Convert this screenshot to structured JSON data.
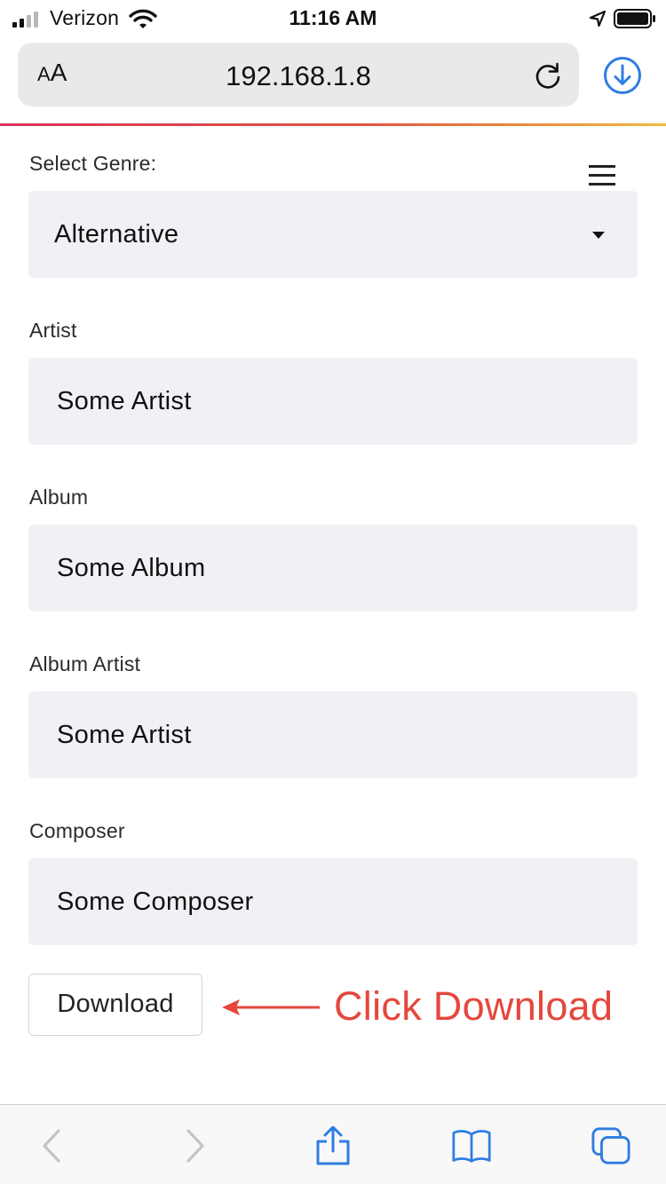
{
  "status_bar": {
    "carrier": "Verizon",
    "time": "11:16 AM"
  },
  "browser": {
    "text_size_small": "A",
    "text_size_large": "A",
    "url": "192.168.1.8",
    "accent_color": "#2f7de1",
    "progress_colors": [
      "#d8325a",
      "#f2b93f"
    ]
  },
  "form": {
    "genre_label": "Select Genre:",
    "genre_value": "Alternative",
    "artist_label": "Artist",
    "artist_value": "Some Artist",
    "album_label": "Album",
    "album_value": "Some Album",
    "album_artist_label": "Album Artist",
    "album_artist_value": "Some Artist",
    "composer_label": "Composer",
    "composer_value": "Some Composer",
    "download_label": "Download"
  },
  "annotation": {
    "text": "Click Download",
    "color": "#e5473d"
  },
  "icons": {
    "status": [
      "signal-icon",
      "wifi-icon",
      "location-arrow-icon",
      "battery-icon"
    ],
    "browser": [
      "reload-icon",
      "download-indicator-icon"
    ],
    "page": [
      "hamburger-menu-icon",
      "dropdown-caret-icon"
    ],
    "toolbar": [
      "back-icon",
      "forward-icon",
      "share-icon",
      "bookmarks-icon",
      "tabs-icon"
    ]
  }
}
